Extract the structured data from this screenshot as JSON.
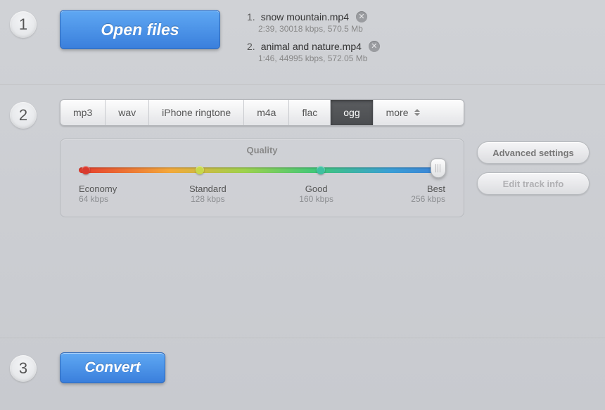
{
  "steps": {
    "one": "1",
    "two": "2",
    "three": "3"
  },
  "buttons": {
    "open_files": "Open files",
    "convert": "Convert",
    "advanced_settings": "Advanced settings",
    "edit_track_info": "Edit track info"
  },
  "files": [
    {
      "num": "1.",
      "name": "snow mountain.mp4",
      "meta": "2:39, 30018 kbps, 570.5 Mb"
    },
    {
      "num": "2.",
      "name": "animal and nature.mp4",
      "meta": "1:46, 44995 kbps, 572.05 Mb"
    }
  ],
  "formats": {
    "tabs": [
      "mp3",
      "wav",
      "iPhone ringtone",
      "m4a",
      "flac",
      "ogg"
    ],
    "more_label": "more",
    "active_index": 5
  },
  "quality": {
    "title": "Quality",
    "handle_pct": 98,
    "nodes": [
      {
        "pct": 2,
        "color": "#d93a2e"
      },
      {
        "pct": 33,
        "color": "#c8d84a"
      },
      {
        "pct": 66,
        "color": "#3fc0a0"
      },
      {
        "pct": 98,
        "color": "#3c7fd6"
      }
    ],
    "labels": [
      {
        "main": "Economy",
        "sub": "64 kbps"
      },
      {
        "main": "Standard",
        "sub": "128 kbps"
      },
      {
        "main": "Good",
        "sub": "160 kbps"
      },
      {
        "main": "Best",
        "sub": "256 kbps"
      }
    ]
  }
}
